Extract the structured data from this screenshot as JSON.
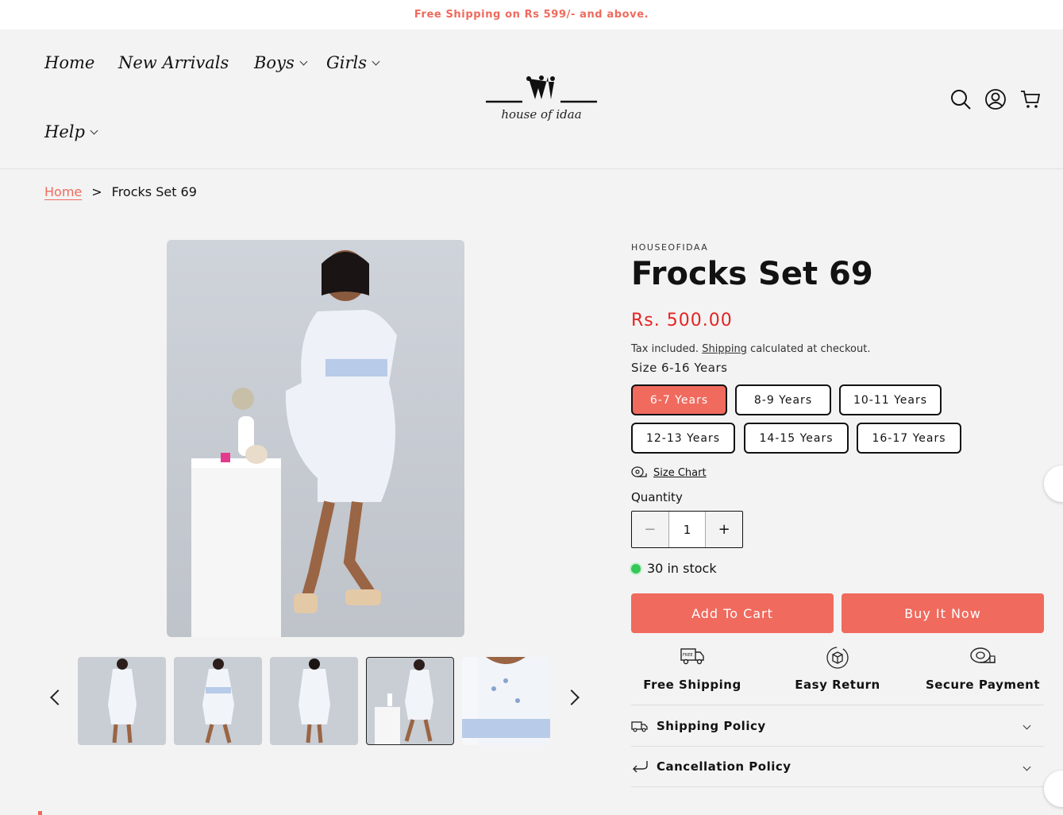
{
  "announcement": "Free Shipping on Rs 599/- and above.",
  "nav": {
    "items": [
      {
        "label": "Home"
      },
      {
        "label": "New Arrivals"
      },
      {
        "label": "Boys"
      },
      {
        "label": "Girls"
      },
      {
        "label": "Help"
      }
    ]
  },
  "logo": {
    "text": "house of idaa"
  },
  "header_icons": [
    "search-icon",
    "account-icon",
    "cart-icon"
  ],
  "breadcrumb": {
    "home": "Home",
    "separator": ">",
    "current": "Frocks Set 69"
  },
  "product": {
    "vendor": "HOUSEOFIDAA",
    "title": "Frocks Set 69",
    "price": "Rs. 500.00",
    "tax_prefix": "Tax included.",
    "tax_link": "Shipping",
    "tax_suffix": "calculated at checkout.",
    "size_label": "Size 6-16 Years",
    "sizes": [
      "6-7 Years",
      "8-9 Years",
      "10-11 Years",
      "12-13 Years",
      "14-15 Years",
      "16-17 Years"
    ],
    "selected_size": "6-7 Years",
    "size_chart": "Size Chart",
    "quantity_label": "Quantity",
    "quantity": "1",
    "stock": "30 in stock",
    "add_to_cart": "Add To Cart",
    "buy_now": "Buy It Now"
  },
  "features": [
    {
      "label": "Free Shipping",
      "icon": "truck-icon"
    },
    {
      "label": "Easy Return",
      "icon": "return-box-icon"
    },
    {
      "label": "Secure Payment",
      "icon": "payment-icon"
    }
  ],
  "accordions": [
    {
      "label": "Shipping Policy",
      "icon": "truck-icon"
    },
    {
      "label": "Cancellation Policy",
      "icon": "return-arrow-icon"
    }
  ],
  "colors": {
    "accent": "#f06a5e",
    "price": "#e52323",
    "stock": "#34c759"
  }
}
